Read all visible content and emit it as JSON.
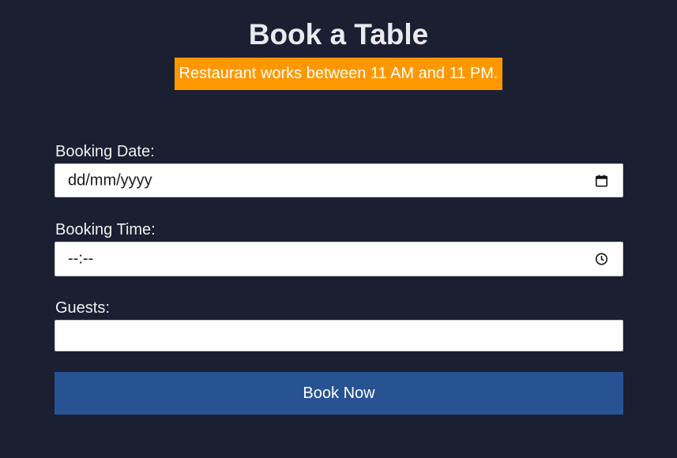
{
  "page": {
    "title": "Book a Table",
    "notice": "Restaurant works between 11 AM and 11 PM."
  },
  "form": {
    "date": {
      "label": "Booking Date:",
      "placeholder": "dd/mm/yyyy",
      "value": "",
      "icon": "calendar-icon"
    },
    "time": {
      "label": "Booking Time:",
      "placeholder": "--:--",
      "value": "",
      "icon": "clock-icon"
    },
    "guests": {
      "label": "Guests:",
      "value": ""
    },
    "submit_label": "Book Now"
  },
  "colors": {
    "background": "#1b1f32",
    "notice_bg": "#ff9800",
    "button_bg": "#275392"
  }
}
